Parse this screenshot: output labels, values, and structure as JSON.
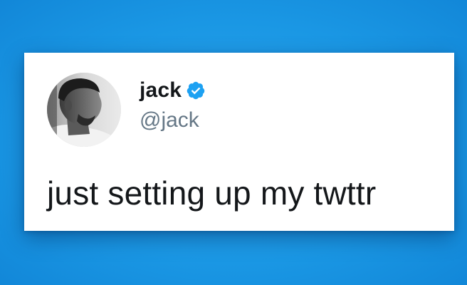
{
  "background_color": "#1da1f2",
  "tweet": {
    "author": {
      "display_name": "jack",
      "handle": "@jack",
      "verified": true,
      "verified_icon": "verified-badge-icon",
      "verified_color": "#1da1f2"
    },
    "text": "just setting up my twttr"
  }
}
